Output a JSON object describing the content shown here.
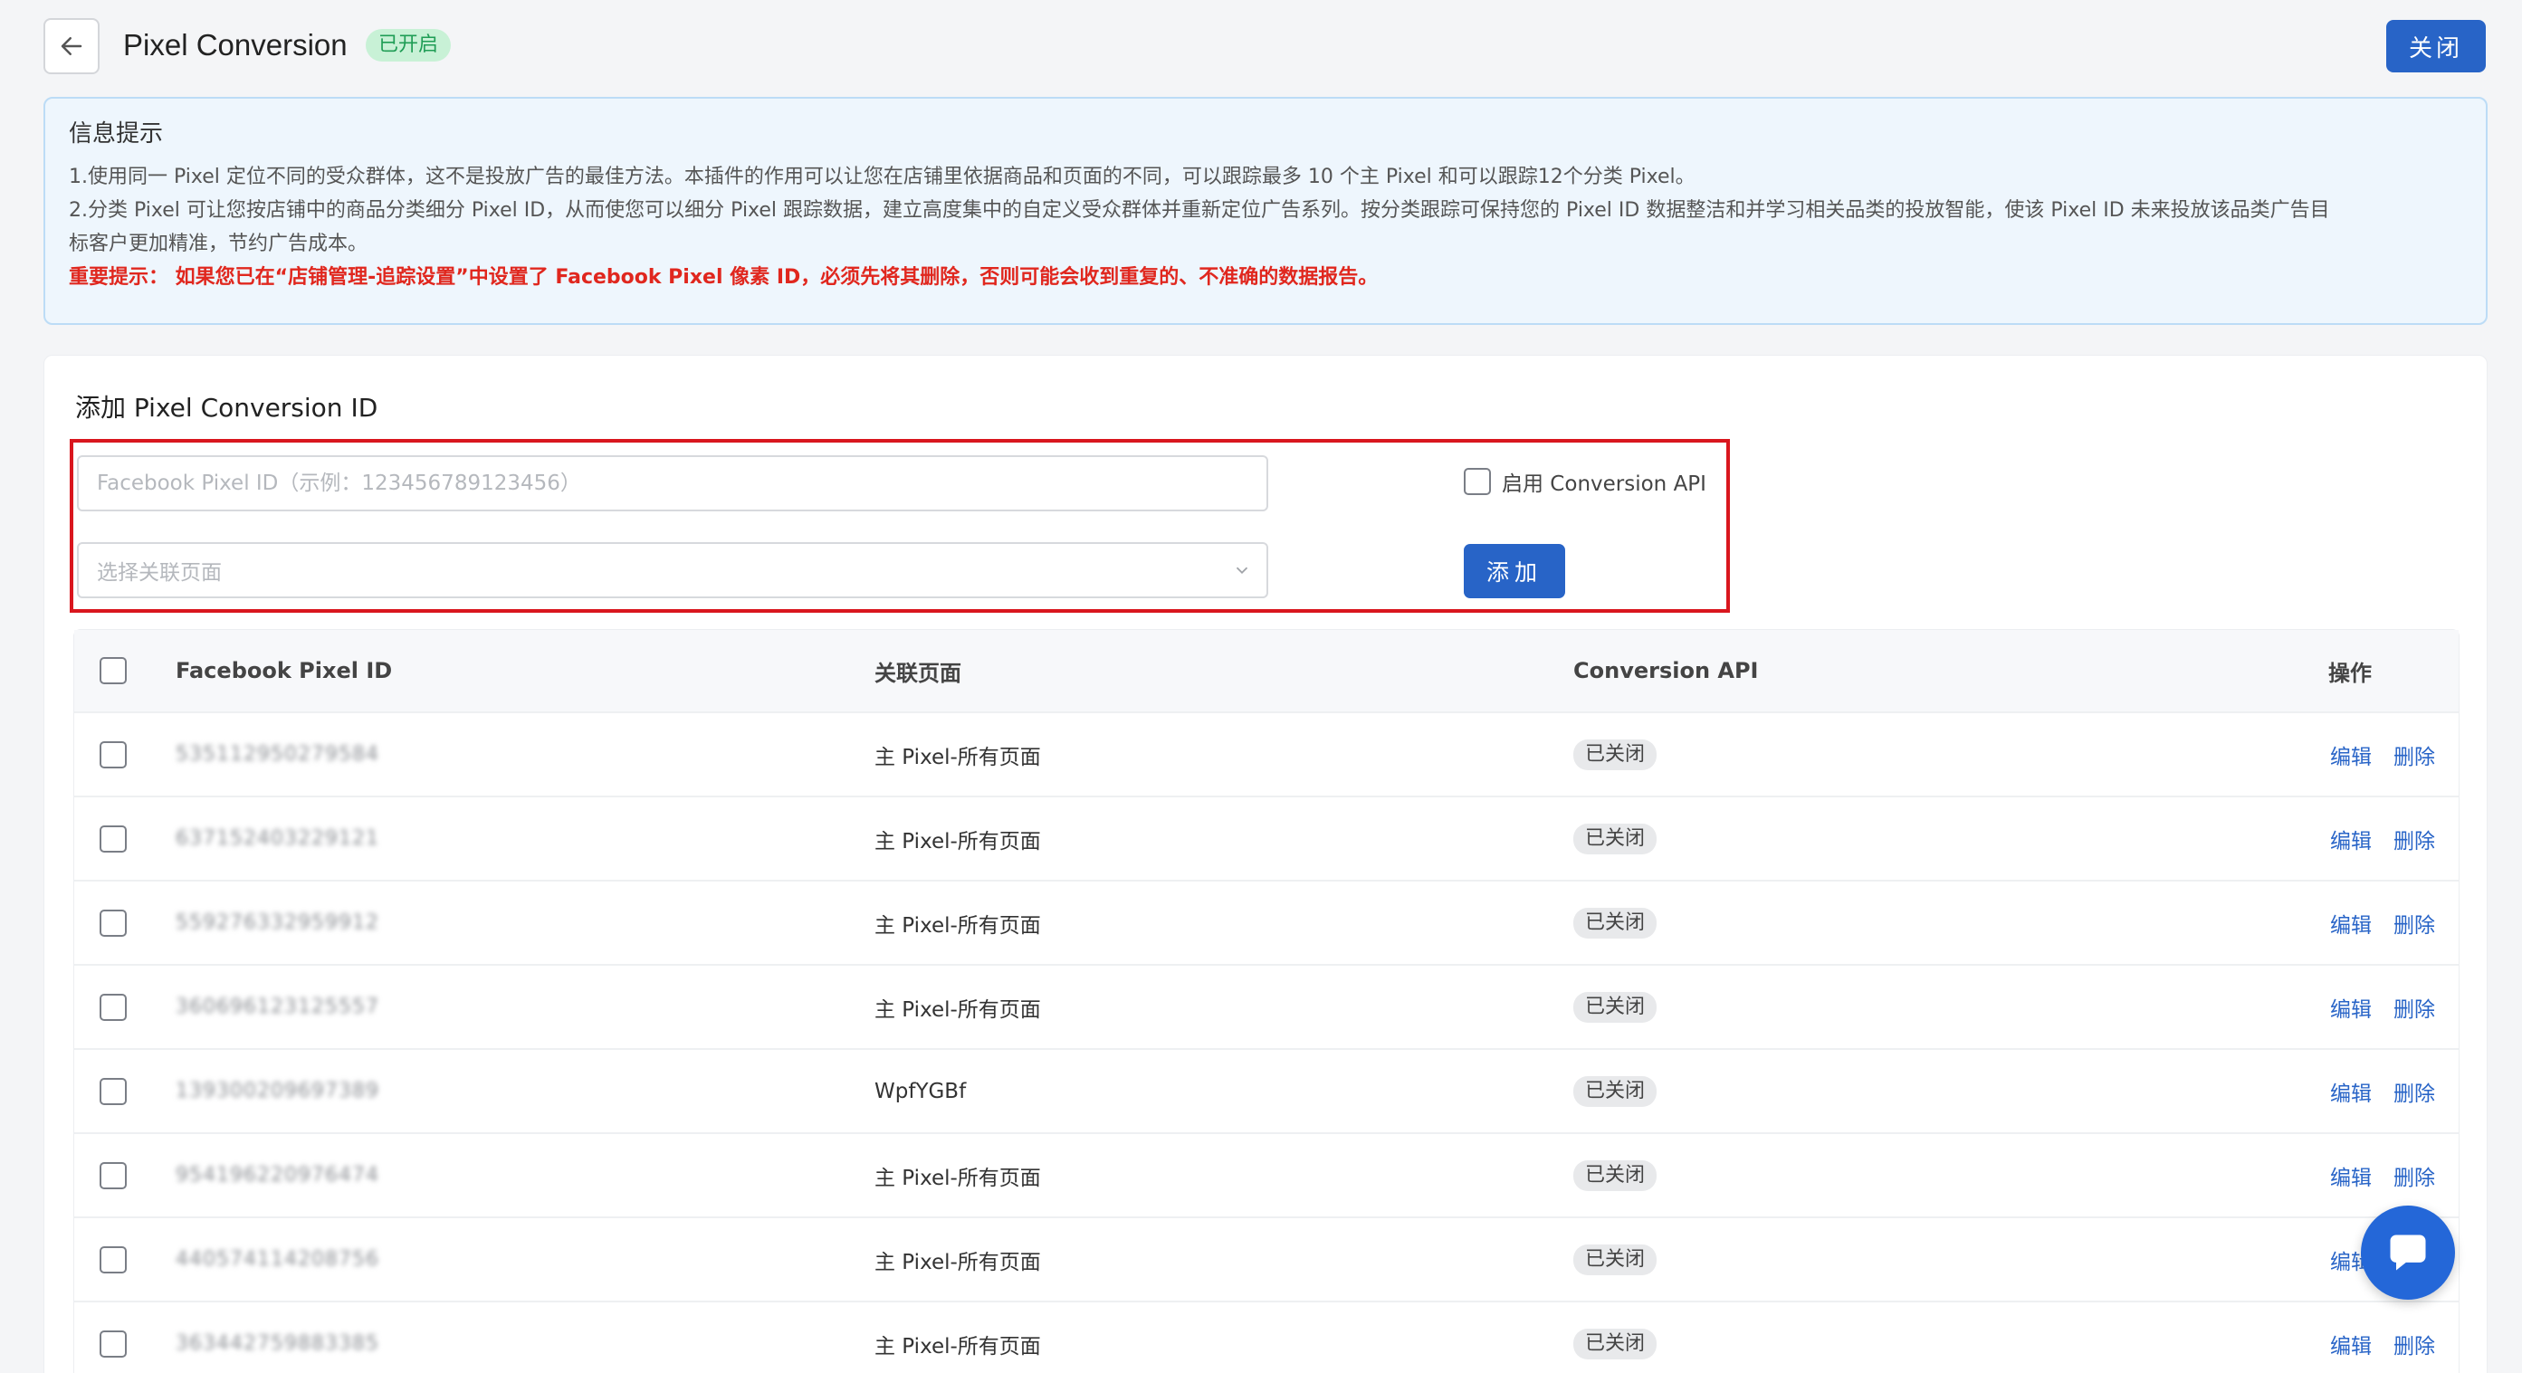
{
  "header": {
    "title": "Pixel Conversion",
    "status_badge": "已开启",
    "close_label": "关闭"
  },
  "info": {
    "title": "信息提示",
    "line1": "1.使用同一 Pixel 定位不同的受众群体，这不是投放广告的最佳方法。本插件的作用可以让您在店铺里依据商品和页面的不同，可以跟踪最多 10 个主 Pixel 和可以跟踪12个分类 Pixel。",
    "line2": "2.分类 Pixel 可让您按店铺中的商品分类细分 Pixel ID，从而使您可以细分 Pixel 跟踪数据，建立高度集中的自定义受众群体并重新定位广告系列。按分类跟踪可保持您的 Pixel ID 数据整洁和并学习相关品类的投放智能，使该 Pixel ID 未来投放该品类广告目",
    "line3": "标客户更加精准，节约广告成本。",
    "warning": "重要提示： 如果您已在“店铺管理-追踪设置”中设置了 Facebook Pixel 像素 ID，必须先将其删除，否则可能会收到重复的、不准确的数据报告。"
  },
  "add_form": {
    "title": "添加 Pixel Conversion ID",
    "pixel_placeholder": "Facebook Pixel ID（示例：123456789123456）",
    "page_select_placeholder": "选择关联页面",
    "capi_label": "启用 Conversion API",
    "add_label": "添加"
  },
  "table": {
    "headers": {
      "id": "Facebook Pixel ID",
      "page": "关联页面",
      "capi": "Conversion API",
      "ops": "操作"
    },
    "edit_label": "编辑",
    "delete_label": "删除",
    "rows": [
      {
        "id": "535112950279584",
        "page": "主 Pixel-所有页面",
        "capi": "已关闭"
      },
      {
        "id": "637152403229121",
        "page": "主 Pixel-所有页面",
        "capi": "已关闭"
      },
      {
        "id": "559276332959912",
        "page": "主 Pixel-所有页面",
        "capi": "已关闭"
      },
      {
        "id": "360696123125557",
        "page": "主 Pixel-所有页面",
        "capi": "已关闭"
      },
      {
        "id": "139300209697389",
        "page": "WpfYGBf",
        "capi": "已关闭"
      },
      {
        "id": "954196220976474",
        "page": "主 Pixel-所有页面",
        "capi": "已关闭"
      },
      {
        "id": "440574114208756",
        "page": "主 Pixel-所有页面",
        "capi": "已关闭"
      },
      {
        "id": "363442759883385",
        "page": "主 Pixel-所有页面",
        "capi": "已关闭"
      }
    ]
  },
  "colors": {
    "primary": "#2864c7",
    "warning": "#e0271e",
    "badge_green": "#c8f1d6"
  }
}
